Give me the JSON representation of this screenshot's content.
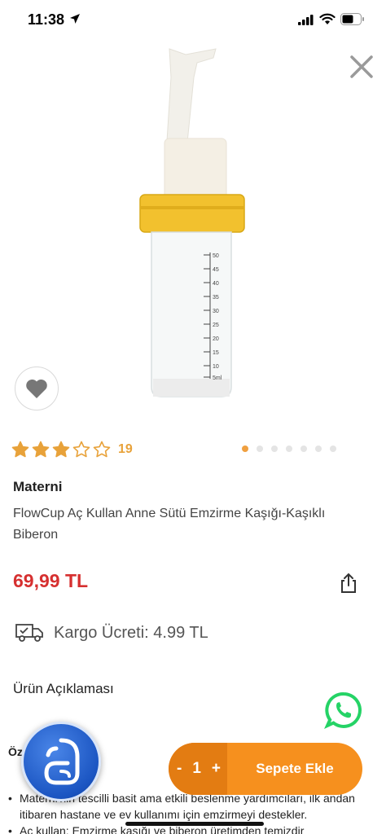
{
  "status_bar": {
    "time": "11:38"
  },
  "product": {
    "rating_value": 3,
    "rating_max": 5,
    "review_count": "19",
    "image_count": 7,
    "active_image": 1,
    "brand": "Materni",
    "title": "FlowCup Aç Kullan Anne Sütü Emzirme Kaşığı-Kaşıklı Biberon",
    "price": "69,99 TL",
    "shipping": "Kargo Ücreti: 4.99 TL"
  },
  "description": {
    "header": "Ürün Açıklaması",
    "section_partial": "Öz",
    "items": [
      "Materni'nin tescilli basit ama etkili beslenme yardımcıları, ilk andan itibaren hastane ve ev kullanımı için emzirmeyi destekler.",
      "Aç kullan: Emzirme kaşığı ve biberon üretimden temizdir"
    ]
  },
  "cart": {
    "minus": "-",
    "quantity": "1",
    "plus": "+",
    "add_label": "Sepete Ekle"
  },
  "colors": {
    "accent": "#f6901e",
    "price": "#d63030",
    "star": "#e8a23a",
    "whatsapp": "#25d366"
  },
  "icons": [
    "location-arrow-icon",
    "signal-icon",
    "wifi-icon",
    "battery-icon",
    "close-icon",
    "heart-icon",
    "star-icon",
    "share-icon",
    "truck-icon",
    "whatsapp-icon"
  ]
}
